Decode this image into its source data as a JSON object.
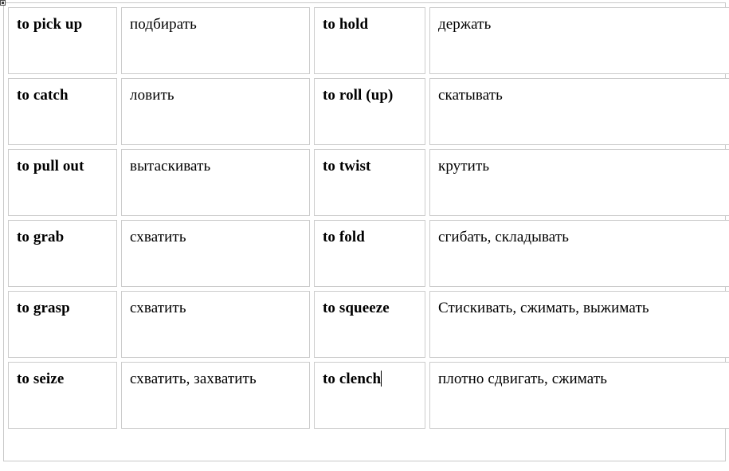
{
  "document": {
    "type": "word-processor-table",
    "columns": 4,
    "rows": 6,
    "border_color": "#cccccc",
    "outer_border_color": "#c9c9c9",
    "background_color": "#ffffff",
    "text_color": "#000000"
  },
  "table": {
    "rows": [
      {
        "term_left": "to pick up",
        "gloss_left": "подбирать",
        "term_right": "to hold",
        "gloss_right": "держать"
      },
      {
        "term_left": "to catch",
        "gloss_left": "ловить",
        "term_right": "to roll (up)",
        "gloss_right": "скатывать"
      },
      {
        "term_left": "to pull out",
        "gloss_left": "вытаскивать",
        "term_right": "to twist",
        "gloss_right": "крутить"
      },
      {
        "term_left": "to grab",
        "gloss_left": "схватить",
        "term_right": "to fold",
        "gloss_right": "сгибать, складывать"
      },
      {
        "term_left": "to grasp",
        "gloss_left": "схватить",
        "term_right": "to squeeze",
        "gloss_right": "Стискивать, сжимать, выжимать"
      },
      {
        "term_left": "to seize",
        "gloss_left": "схватить, захватить",
        "term_right": "to clench",
        "gloss_right": "плотно сдвигать, сжимать"
      }
    ]
  },
  "cursor": {
    "location": "row-6-term-right",
    "after_text": "to clench"
  },
  "handle": {
    "name": "table-move-handle"
  }
}
